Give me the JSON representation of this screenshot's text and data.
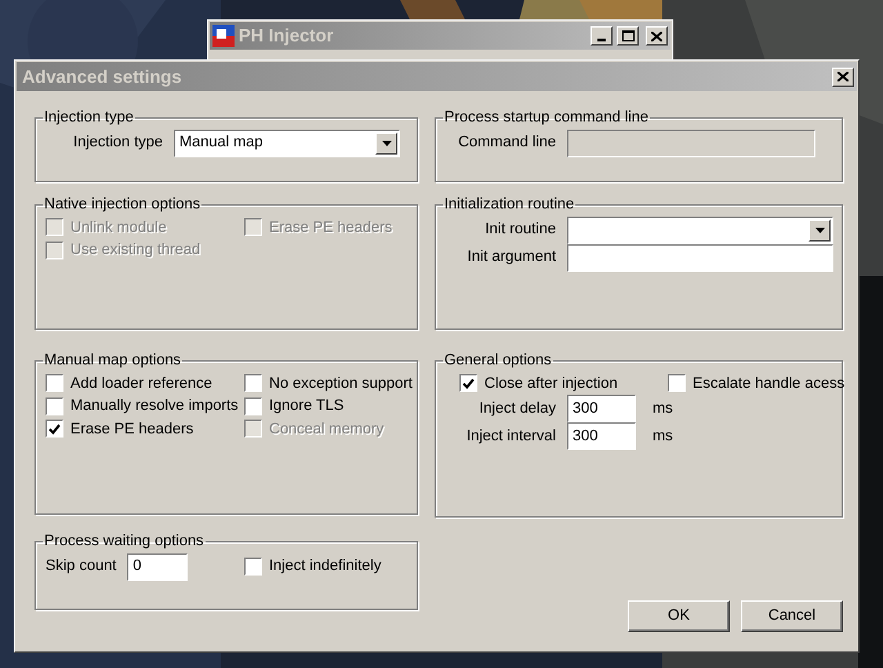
{
  "background_window": {
    "title": "PH Injector"
  },
  "dialog": {
    "title": "Advanced settings"
  },
  "left_column": [
    {
      "title": "Injection type",
      "rows": [
        {
          "items": [
            {
              "kind": "dropdown",
              "label": "Injection type",
              "value": "Manual map"
            }
          ]
        }
      ]
    },
    {
      "title": "Native injection options",
      "rows": [
        {
          "items": [
            {
              "kind": "checkbox",
              "label": "Unlink module",
              "checked": false,
              "disabled": true
            },
            {
              "kind": "checkbox",
              "label": "Erase PE headers",
              "checked": false,
              "disabled": true
            }
          ]
        },
        {
          "items": [
            {
              "kind": "checkbox",
              "label": "Use existing thread",
              "checked": false,
              "disabled": true
            }
          ]
        }
      ]
    },
    {
      "title": "Manual map options",
      "rows": [
        {
          "items": [
            {
              "kind": "checkbox",
              "label": "Add loader reference",
              "checked": false,
              "disabled": false
            },
            {
              "kind": "checkbox",
              "label": "No exception support",
              "checked": false,
              "disabled": false
            }
          ]
        },
        {
          "items": [
            {
              "kind": "checkbox",
              "label": "Manually resolve imports",
              "checked": false,
              "disabled": false
            },
            {
              "kind": "checkbox",
              "label": "Ignore TLS",
              "checked": false,
              "disabled": false
            }
          ]
        },
        {
          "items": [
            {
              "kind": "checkbox",
              "label": "Erase PE headers",
              "checked": true,
              "disabled": false
            },
            {
              "kind": "checkbox",
              "label": "Conceal memory",
              "checked": false,
              "disabled": true
            }
          ]
        }
      ]
    },
    {
      "title": "Process waiting options",
      "rows": [
        {
          "items": [
            {
              "kind": "textbox",
              "label": "Skip count",
              "value": "0",
              "disabled": false
            },
            {
              "kind": "checkbox",
              "label": "Inject indefinitely",
              "checked": false,
              "disabled": false
            }
          ]
        }
      ]
    }
  ],
  "right_column": [
    {
      "title": "Process startup command line",
      "rows": [
        {
          "items": [
            {
              "kind": "textbox",
              "label": "Command line",
              "value": "",
              "disabled": true
            }
          ]
        }
      ]
    },
    {
      "title": "Initialization routine",
      "rows": [
        {
          "items": [
            {
              "kind": "dropdown",
              "label": "Init routine",
              "value": ""
            }
          ]
        },
        {
          "items": [
            {
              "kind": "textbox",
              "label": "Init argument",
              "value": "",
              "disabled": false
            }
          ]
        }
      ]
    },
    {
      "title": "General options",
      "rows": [
        {
          "items": [
            {
              "kind": "checkbox",
              "label": "Close after injection",
              "checked": true,
              "disabled": false
            },
            {
              "kind": "checkbox",
              "label": "Escalate handle acess",
              "checked": false,
              "disabled": false
            }
          ]
        },
        {
          "items": [
            {
              "kind": "textbox",
              "label": "Inject delay",
              "value": "300",
              "unit": "ms",
              "disabled": false
            }
          ]
        },
        {
          "items": [
            {
              "kind": "textbox",
              "label": "Inject interval",
              "value": "300",
              "unit": "ms",
              "disabled": false
            }
          ]
        }
      ]
    }
  ],
  "buttons": [
    {
      "label": "OK"
    },
    {
      "label": "Cancel"
    }
  ]
}
